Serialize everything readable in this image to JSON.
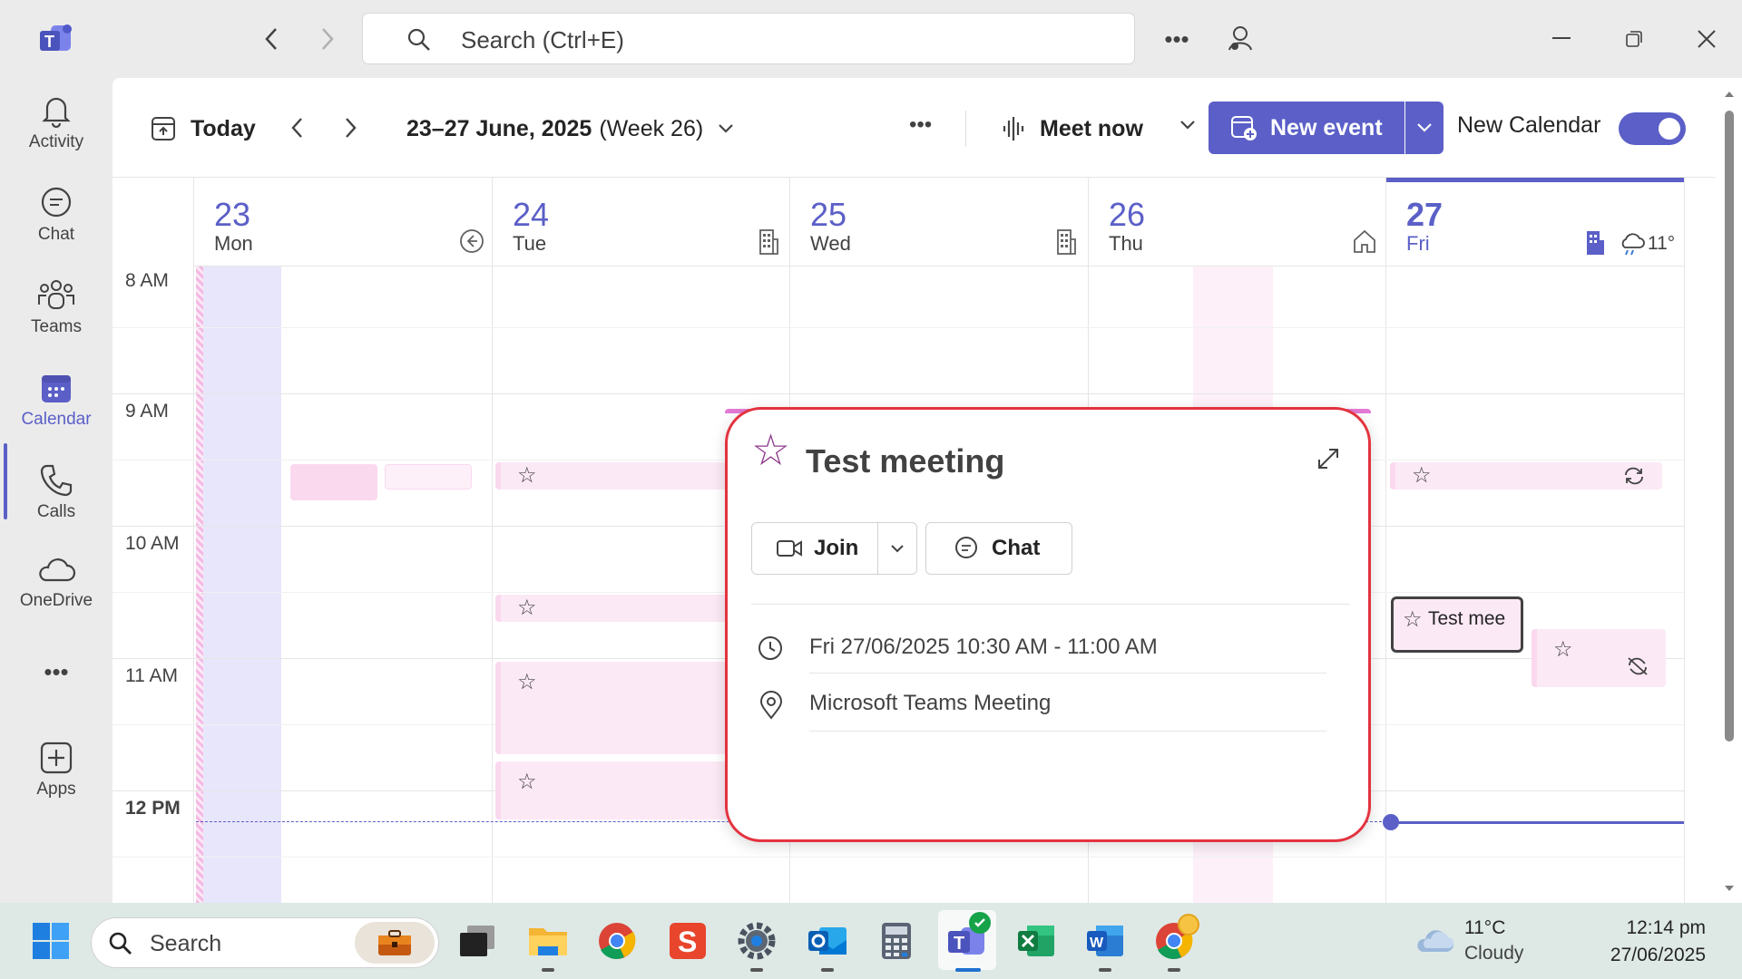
{
  "window": {
    "search_placeholder": "Search (Ctrl+E)"
  },
  "rail": {
    "items": [
      {
        "label": "Activity",
        "icon": "bell-icon"
      },
      {
        "label": "Chat",
        "icon": "chat-icon"
      },
      {
        "label": "Teams",
        "icon": "teams-icon"
      },
      {
        "label": "Calendar",
        "icon": "calendar-icon",
        "active": true
      },
      {
        "label": "Calls",
        "icon": "phone-icon"
      },
      {
        "label": "OneDrive",
        "icon": "cloud-icon"
      },
      {
        "label": "Apps",
        "icon": "add-apps-icon"
      }
    ]
  },
  "toolbar": {
    "today": "Today",
    "date_range": "23–27 June, 2025",
    "week": "(Week 26)",
    "meet_now": "Meet now",
    "new_event": "New event",
    "new_calendar": "New Calendar"
  },
  "days": [
    {
      "num": "23",
      "name": "Mon",
      "icon": "arrow-left-circle-icon"
    },
    {
      "num": "24",
      "name": "Tue",
      "icon": "building-icon"
    },
    {
      "num": "25",
      "name": "Wed",
      "icon": "building-icon"
    },
    {
      "num": "26",
      "name": "Thu",
      "icon": "home-icon"
    },
    {
      "num": "27",
      "name": "Fri",
      "icon": "building-icon",
      "today": true,
      "weather": "11°"
    }
  ],
  "times": [
    "8 AM",
    "9 AM",
    "10 AM",
    "11 AM",
    "12 PM"
  ],
  "popup": {
    "title": "Test meeting",
    "join": "Join",
    "chat": "Chat",
    "when": "Fri 27/06/2025 10:30 AM - 11:00 AM",
    "where": "Microsoft Teams Meeting"
  },
  "selected_event": {
    "title": "Test mee"
  },
  "taskbar": {
    "search": "Search",
    "weather_temp": "11°C",
    "weather_desc": "Cloudy",
    "time": "12:14 pm",
    "date": "27/06/2025"
  },
  "colors": {
    "accent": "#5b5fc7",
    "event_bg": "#fce9f6",
    "popup_border": "#e3333f"
  }
}
